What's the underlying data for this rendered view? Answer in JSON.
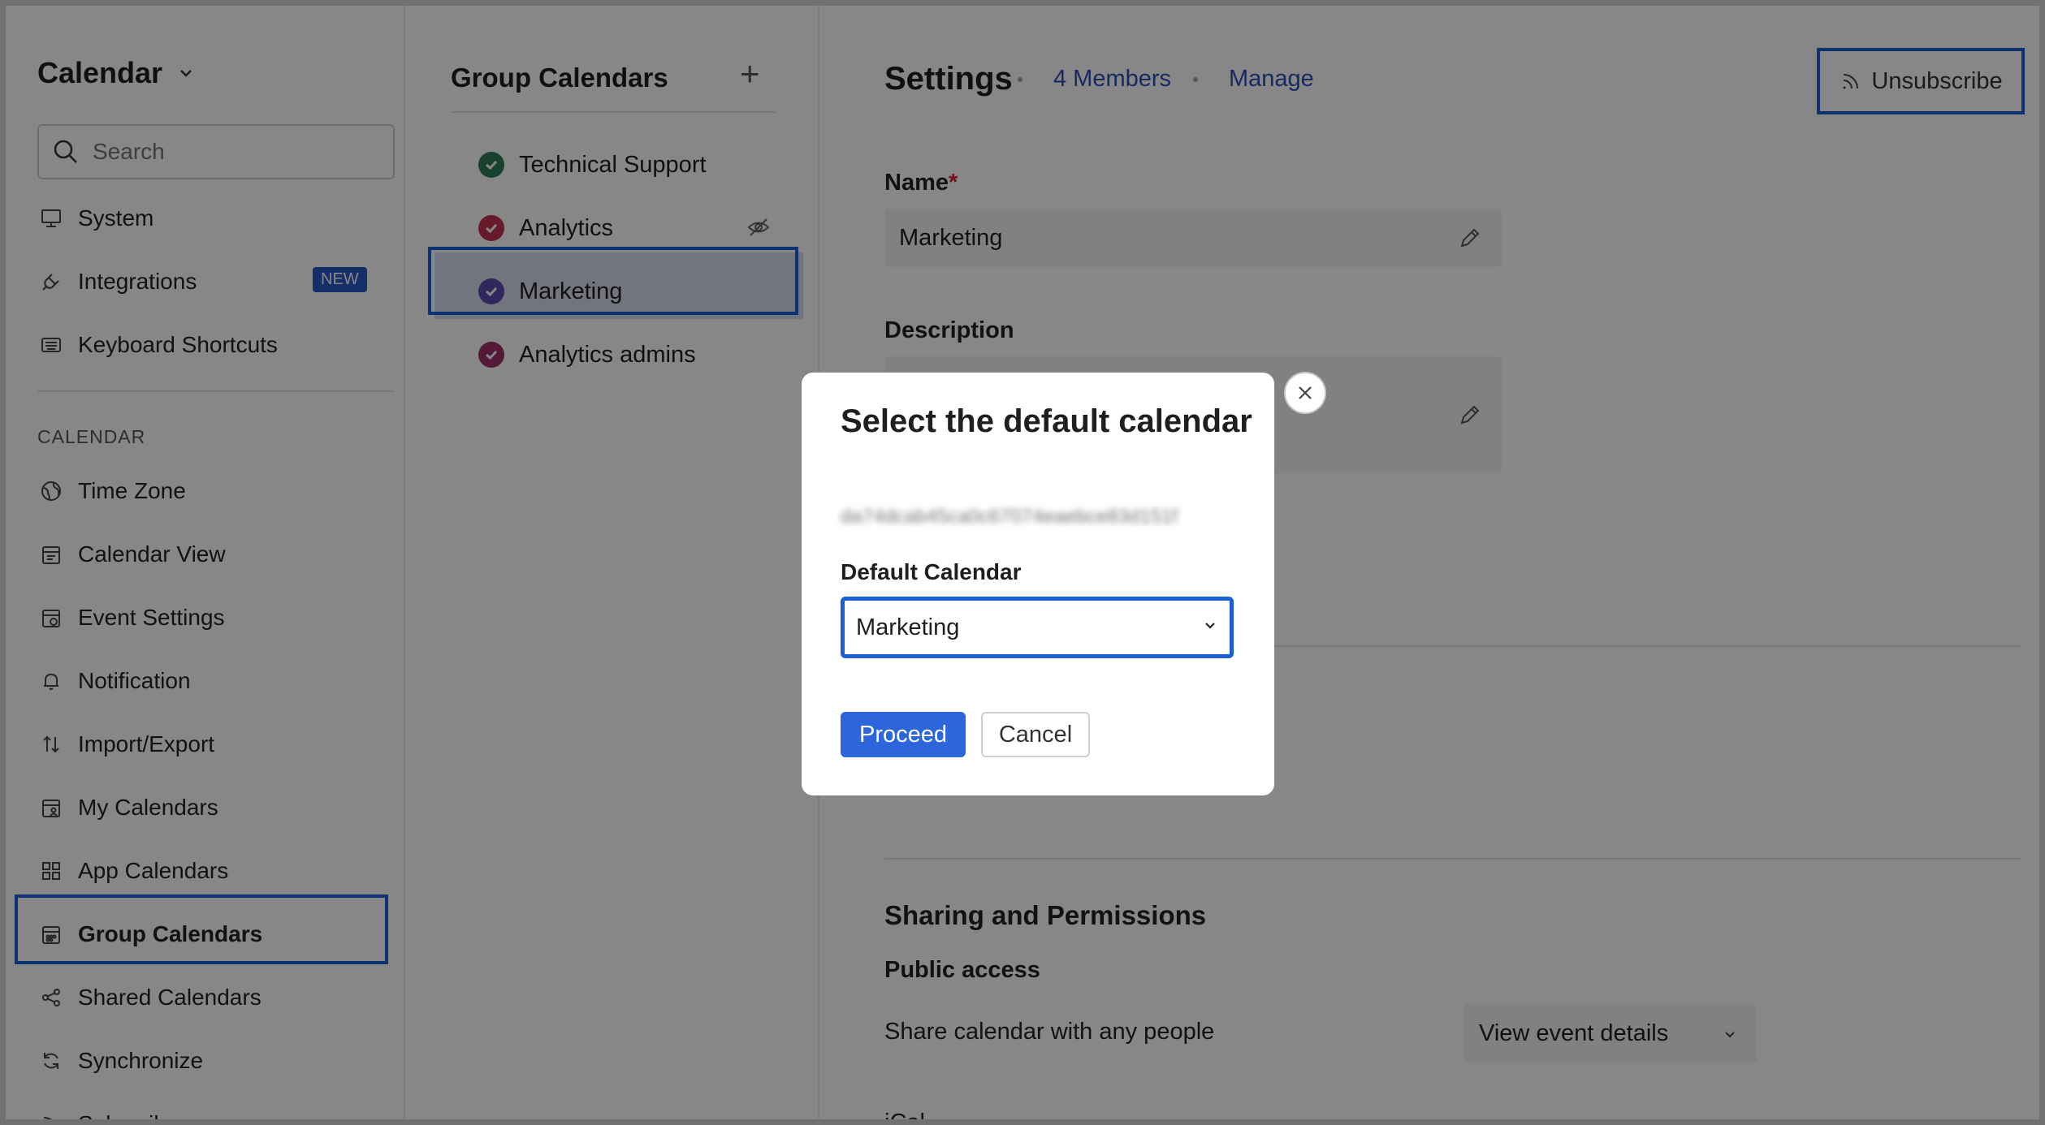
{
  "sidebar": {
    "title": "Calendar",
    "search_placeholder": "Search",
    "items_top": [
      {
        "label": "System",
        "icon": "monitor-icon"
      },
      {
        "label": "Integrations",
        "icon": "plug-icon",
        "badge": "NEW"
      },
      {
        "label": "Keyboard Shortcuts",
        "icon": "keyboard-icon"
      }
    ],
    "section_label": "CALENDAR",
    "items": [
      {
        "label": "Time Zone",
        "icon": "globe-icon"
      },
      {
        "label": "Calendar View",
        "icon": "calendar-view-icon"
      },
      {
        "label": "Event Settings",
        "icon": "calendar-gear-icon"
      },
      {
        "label": "Notification",
        "icon": "bell-icon"
      },
      {
        "label": "Import/Export",
        "icon": "arrows-updown-icon"
      },
      {
        "label": "My Calendars",
        "icon": "calendar-user-icon"
      },
      {
        "label": "App Calendars",
        "icon": "apps-grid-icon"
      },
      {
        "label": "Group Calendars",
        "icon": "group-calendar-icon",
        "selected": true
      },
      {
        "label": "Shared Calendars",
        "icon": "share-icon"
      },
      {
        "label": "Synchronize",
        "icon": "sync-icon"
      },
      {
        "label": "Subscribe",
        "icon": "rss-icon"
      }
    ]
  },
  "groups": {
    "title": "Group Calendars",
    "items": [
      {
        "label": "Technical Support",
        "color": "#2f7d5a"
      },
      {
        "label": "Analytics",
        "color": "#c03253",
        "hidden": true
      },
      {
        "label": "Marketing",
        "color": "#5b4bb0",
        "selected": true
      },
      {
        "label": "Analytics admins",
        "color": "#a0306a"
      }
    ]
  },
  "settings": {
    "title": "Settings",
    "members_link": "4 Members",
    "manage_link": "Manage",
    "unsubscribe_label": "Unsubscribe",
    "name_label": "Name",
    "name_required": "*",
    "name_value": "Marketing",
    "calendar_color": "#5b4bb0",
    "description_label": "Description",
    "sharing_title": "Sharing and Permissions",
    "public_access_label": "Public access",
    "share_text": "Share calendar with any people",
    "share_select_value": "View event details",
    "ical_label": "iCal"
  },
  "modal": {
    "title": "Select the default calendar",
    "obscured_id": "da74dcab45ca0c67074eaebce83d151f",
    "field_label": "Default Calendar",
    "selected_value": "Marketing",
    "proceed_label": "Proceed",
    "cancel_label": "Cancel"
  }
}
